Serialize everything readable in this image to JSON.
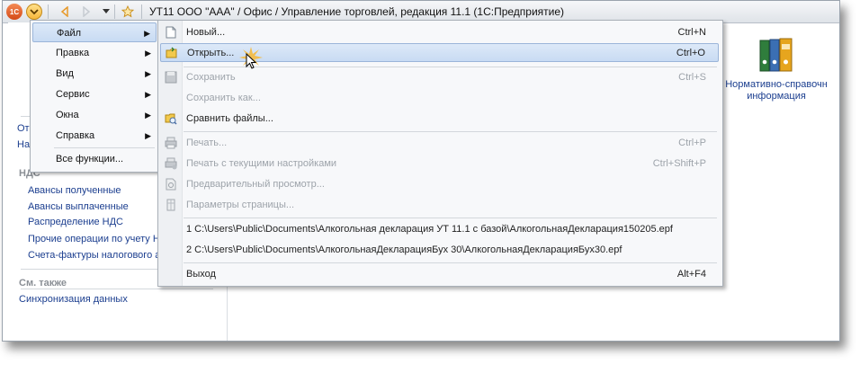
{
  "window": {
    "title": "УТ11 ООО \"ААА\" / Офис / Управление торговлей, редакция 11.1  (1С:Предприятие)",
    "logo_text": "1С"
  },
  "left_panel": {
    "partial_items": [
      "От",
      "На"
    ],
    "nds_heading": "НДС",
    "nds_items": [
      "Авансы полученные",
      "Авансы выплаченные",
      "Распределение НДС",
      "Прочие операции по учету НДС",
      "Счета-фактуры налогового а"
    ],
    "see_also_heading": "См. также",
    "see_also_items": [
      "Синхронизация данных"
    ]
  },
  "right_panel": {
    "nsi_label_line1": "Нормативно-справочн",
    "nsi_label_line2": "информация"
  },
  "main_menu": {
    "items": [
      {
        "label": "Файл",
        "submenu": true
      },
      {
        "label": "Правка",
        "submenu": true
      },
      {
        "label": "Вид",
        "submenu": true
      },
      {
        "label": "Сервис",
        "submenu": true
      },
      {
        "label": "Окна",
        "submenu": true
      },
      {
        "label": "Справка",
        "submenu": true
      }
    ],
    "all_functions": "Все функции...",
    "active_index": 0
  },
  "file_menu": {
    "new": {
      "label": "Новый...",
      "shortcut": "Ctrl+N"
    },
    "open": {
      "label": "Открыть...",
      "shortcut": "Ctrl+O"
    },
    "save": {
      "label": "Сохранить",
      "shortcut": "Ctrl+S"
    },
    "save_as": {
      "label": "Сохранить как...",
      "shortcut": ""
    },
    "compare": {
      "label": "Сравнить файлы...",
      "shortcut": ""
    },
    "print": {
      "label": "Печать...",
      "shortcut": "Ctrl+P"
    },
    "print_current": {
      "label": "Печать с текущими настройками",
      "shortcut": "Ctrl+Shift+P"
    },
    "preview": {
      "label": "Предварительный просмотр...",
      "shortcut": ""
    },
    "page_setup": {
      "label": "Параметры страницы...",
      "shortcut": ""
    },
    "recent_1": {
      "label": "1 C:\\Users\\Public\\Documents\\Алкогольная декларация УТ 11.1 с базой\\АлкогольнаяДекларация150205.epf"
    },
    "recent_2": {
      "label": "2 C:\\Users\\Public\\Documents\\АлкогольнаяДекларацияБух 30\\АлкогольнаяДекларацияБух30.epf"
    },
    "exit": {
      "label": "Выход",
      "shortcut": "Alt+F4"
    }
  },
  "colors": {
    "highlight": "#c8dbf3",
    "link": "#1b3e8f",
    "disabled": "#9da3aa"
  }
}
